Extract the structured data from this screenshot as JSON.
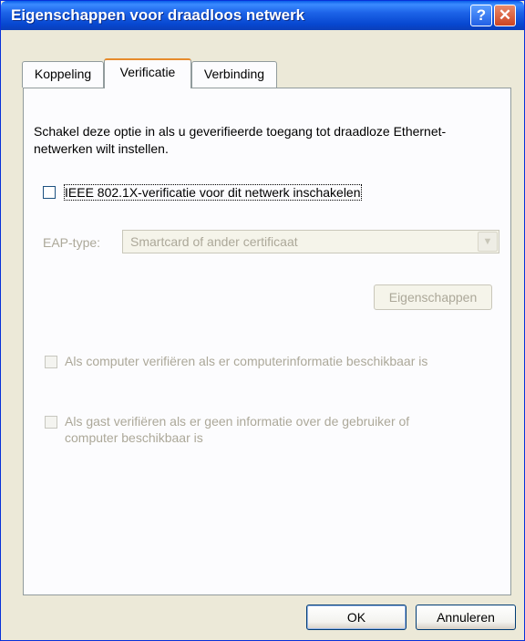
{
  "window": {
    "title": "Eigenschappen voor draadloos netwerk",
    "help_glyph": "?",
    "close_glyph": "✕",
    "help_icon": "help-icon",
    "close_icon": "close-icon"
  },
  "tabs": [
    {
      "label": "Koppeling",
      "active": false
    },
    {
      "label": "Verificatie",
      "active": true
    },
    {
      "label": "Verbinding",
      "active": false
    }
  ],
  "verification": {
    "description": "Schakel deze optie in als u geverifieerde toegang tot draadloze Ethernet-netwerken wilt instellen.",
    "ieee_checkbox_label": "IEEE 802.1X-verificatie voor dit netwerk inschakelen",
    "ieee_checked": false,
    "eap_label": "EAP-type:",
    "eap_value": "Smartcard of ander certificaat",
    "properties_button": "Eigenschappen",
    "computer_checkbox_label": "Als computer verifiëren als er computerinformatie beschikbaar is",
    "computer_checked": false,
    "guest_checkbox_label_line1": "Als gast verifiëren als er geen informatie over de gebruiker of",
    "guest_checkbox_label_line2": "computer beschikbaar is",
    "guest_checked": false
  },
  "buttons": {
    "ok": "OK",
    "cancel": "Annuleren"
  },
  "colors": {
    "titlebar": "#0a5fe9",
    "dialog_bg": "#ece9d8",
    "panel_bg": "#fcfcfe",
    "active_tab_accent": "#e68b2c",
    "disabled_text": "#aca899"
  }
}
